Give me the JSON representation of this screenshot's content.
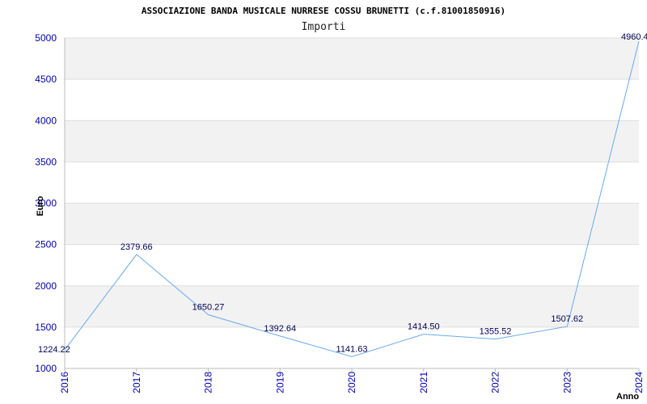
{
  "colors": {
    "line": "#6aaaea",
    "band": "#f2f2f2",
    "grid": "#dddddd",
    "axis": "#bbbbbb",
    "tick_text": "#0000aa",
    "label_text": "#000055"
  },
  "chart_data": {
    "type": "line",
    "title": "ASSOCIAZIONE BANDA MUSICALE NURRESE COSSU BRUNETTI (c.f.81001850916)",
    "subtitle": "Importi",
    "xlabel": "Anno",
    "ylabel": "Euro",
    "ylim": [
      1000,
      5000
    ],
    "yticks": [
      "1000",
      "1500",
      "2000",
      "2500",
      "3000",
      "3500",
      "4000",
      "4500",
      "5000"
    ],
    "categories": [
      "2016",
      "2017",
      "2018",
      "2019",
      "2020",
      "2021",
      "2022",
      "2023",
      "2024"
    ],
    "values": [
      1224.22,
      2379.66,
      1650.27,
      1392.64,
      1141.63,
      1414.5,
      1355.52,
      1507.62,
      4960.4
    ],
    "labels": [
      "1224.22",
      "2379.66",
      "1650.27",
      "1392.64",
      "1141.63",
      "1414.50",
      "1355.52",
      "1507.62",
      "4960.4"
    ],
    "grid": true,
    "legend": "none"
  }
}
